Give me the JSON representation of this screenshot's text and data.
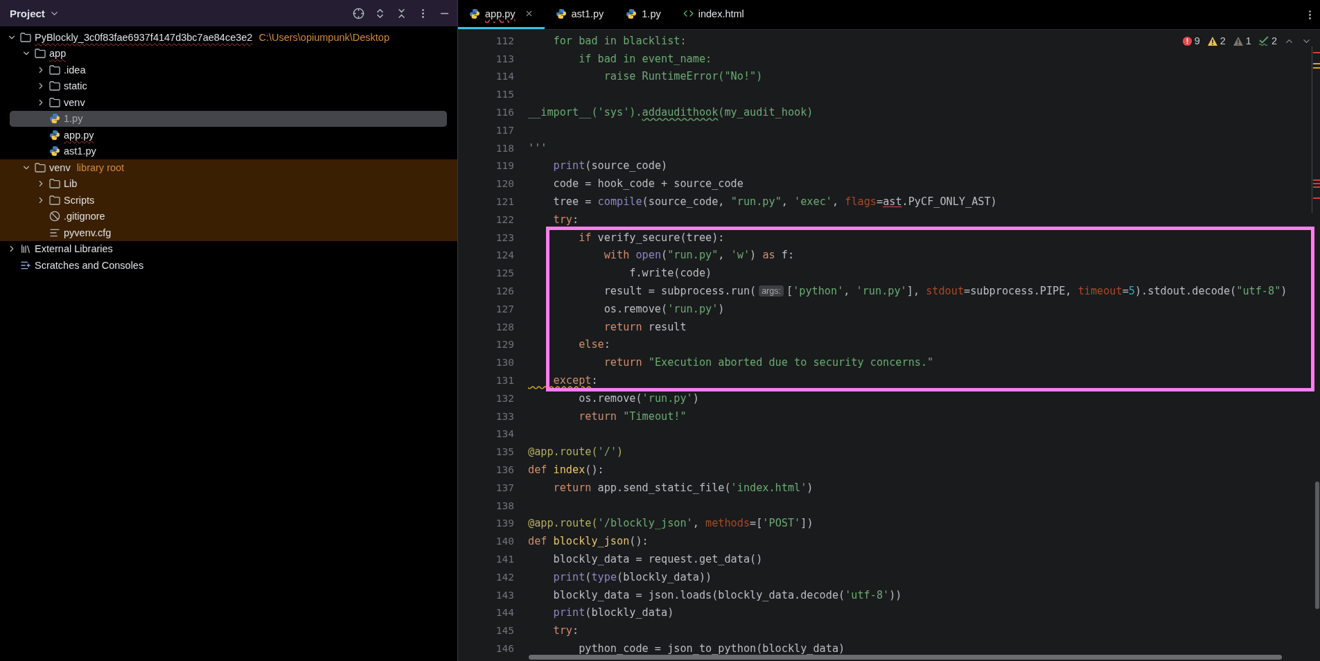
{
  "project_panel": {
    "title": "Project",
    "tree": [
      {
        "name": "PyBlockly_3c0f83fae6937f4147d3bc7ae84ce3e2",
        "kind": "folder",
        "expanded": true,
        "typo": true,
        "hint": "C:\\Users\\opiumpunk\\Desktop",
        "children": [
          {
            "name": "app",
            "kind": "folder",
            "expanded": true,
            "typo": true,
            "children": [
              {
                "name": ".idea",
                "kind": "folder",
                "expanded": false
              },
              {
                "name": "static",
                "kind": "folder",
                "expanded": false
              },
              {
                "name": "venv",
                "kind": "folder",
                "expanded": false
              },
              {
                "name": "1.py",
                "kind": "python",
                "selected": true
              },
              {
                "name": "app.py",
                "kind": "python",
                "selected": false,
                "typo": true
              },
              {
                "name": "ast1.py",
                "kind": "python",
                "selected": false
              }
            ]
          },
          {
            "name": "venv",
            "kind": "folder",
            "expanded": true,
            "library": true,
            "hint": "library root",
            "children": [
              {
                "name": "Lib",
                "kind": "folder",
                "expanded": false
              },
              {
                "name": "Scripts",
                "kind": "folder",
                "expanded": false
              },
              {
                "name": ".gitignore",
                "kind": "ignore"
              },
              {
                "name": "pyvenv.cfg",
                "kind": "config"
              }
            ]
          }
        ]
      },
      {
        "name": "External Libraries",
        "kind": "libraries",
        "expanded": false
      },
      {
        "name": "Scratches and Consoles",
        "kind": "scratches"
      }
    ]
  },
  "tabs": [
    {
      "label": "app.py",
      "kind": "python",
      "selected": true,
      "typo": true
    },
    {
      "label": "ast1.py",
      "kind": "python",
      "selected": false,
      "typo": false
    },
    {
      "label": "1.py",
      "kind": "python",
      "selected": false,
      "typo": false
    },
    {
      "label": "index.html",
      "kind": "html",
      "selected": false,
      "typo": false
    }
  ],
  "problems": [
    {
      "kind": "error",
      "count": "9"
    },
    {
      "kind": "warning",
      "count": "2"
    },
    {
      "kind": "weak",
      "count": "1"
    },
    {
      "kind": "typo",
      "count": "2"
    }
  ],
  "lines": [
    {
      "number": "112",
      "tokens": [
        {
          "text": "    for bad in blacklist:",
          "kind": "str"
        }
      ]
    },
    {
      "number": "113",
      "tokens": [
        {
          "text": "        if bad in event_name:",
          "kind": "str"
        }
      ]
    },
    {
      "number": "114",
      "tokens": [
        {
          "text": "            raise RuntimeError(\"No!\")",
          "kind": "str"
        }
      ]
    },
    {
      "number": "115"
    },
    {
      "number": "116",
      "tokens": [
        {
          "text": "__import__('sys').",
          "kind": "str"
        },
        {
          "text": "addaudithook",
          "kind": "str",
          "typo": true
        },
        {
          "text": "(my_audit_hook)",
          "kind": "str"
        }
      ]
    },
    {
      "number": "117"
    },
    {
      "number": "118",
      "tokens": [
        {
          "text": "'''",
          "kind": "str"
        }
      ]
    },
    {
      "number": "119",
      "tokens": [
        {
          "text": "    print",
          "kind": "call"
        },
        {
          "text": "(source_code)",
          "kind": "plain"
        }
      ]
    },
    {
      "number": "120",
      "tokens": [
        {
          "text": "    code = hook_code + source_code",
          "kind": "plain"
        }
      ]
    },
    {
      "number": "121",
      "tokens": [
        {
          "text": "    tree = ",
          "kind": "plain"
        },
        {
          "text": "compile",
          "kind": "call"
        },
        {
          "text": "(source_code, ",
          "kind": "plain"
        },
        {
          "text": "\"run.py\"",
          "kind": "str"
        },
        {
          "text": ", ",
          "kind": "plain"
        },
        {
          "text": "'exec'",
          "kind": "str"
        },
        {
          "text": ", ",
          "kind": "plain"
        },
        {
          "text": "flags",
          "kind": "param"
        },
        {
          "text": "=",
          "kind": "plain"
        },
        {
          "text": "ast",
          "kind": "plain",
          "error": true
        },
        {
          "text": ".PyCF_ONLY_AST)",
          "kind": "plain"
        }
      ]
    },
    {
      "number": "122",
      "tokens": [
        {
          "text": "    try",
          "kind": "kw"
        },
        {
          "text": ":",
          "kind": "plain"
        }
      ]
    },
    {
      "number": "123",
      "tokens": [
        {
          "text": "        if",
          "kind": "kw"
        },
        {
          "text": " verify_secure(tree):",
          "kind": "plain"
        }
      ]
    },
    {
      "number": "124",
      "tokens": [
        {
          "text": "            with",
          "kind": "kw"
        },
        {
          "text": " open",
          "kind": "call"
        },
        {
          "text": "(",
          "kind": "plain"
        },
        {
          "text": "\"run.py\"",
          "kind": "str"
        },
        {
          "text": ", ",
          "kind": "plain"
        },
        {
          "text": "'w'",
          "kind": "str"
        },
        {
          "text": ") ",
          "kind": "plain"
        },
        {
          "text": "as",
          "kind": "kw"
        },
        {
          "text": " f:",
          "kind": "plain"
        }
      ]
    },
    {
      "number": "125",
      "tokens": [
        {
          "text": "                f.write(code)",
          "kind": "plain"
        }
      ]
    },
    {
      "number": "126",
      "tokens": [
        {
          "text": "            result = subprocess.run(",
          "kind": "plain"
        },
        {
          "text": "args:",
          "kind": "hint"
        },
        {
          "text": "[",
          "kind": "plain"
        },
        {
          "text": "'python'",
          "kind": "str"
        },
        {
          "text": ", ",
          "kind": "plain"
        },
        {
          "text": "'run.py'",
          "kind": "str"
        },
        {
          "text": "], ",
          "kind": "plain"
        },
        {
          "text": "stdout",
          "kind": "param"
        },
        {
          "text": "=subprocess.PIPE, ",
          "kind": "plain"
        },
        {
          "text": "timeout",
          "kind": "param"
        },
        {
          "text": "=",
          "kind": "plain"
        },
        {
          "text": "5",
          "kind": "num"
        },
        {
          "text": ").stdout.decode(",
          "kind": "plain"
        },
        {
          "text": "\"utf-8\"",
          "kind": "str"
        },
        {
          "text": ")",
          "kind": "plain"
        }
      ]
    },
    {
      "number": "127",
      "tokens": [
        {
          "text": "            os.remove(",
          "kind": "plain"
        },
        {
          "text": "'run.py'",
          "kind": "str"
        },
        {
          "text": ")",
          "kind": "plain"
        }
      ]
    },
    {
      "number": "128",
      "tokens": [
        {
          "text": "            return",
          "kind": "kw"
        },
        {
          "text": " result",
          "kind": "plain"
        }
      ]
    },
    {
      "number": "129",
      "tokens": [
        {
          "text": "        else",
          "kind": "kw"
        },
        {
          "text": ":",
          "kind": "plain"
        }
      ]
    },
    {
      "number": "130",
      "tokens": [
        {
          "text": "            return",
          "kind": "kw"
        },
        {
          "text": " \"Execution aborted due to security concerns.\"",
          "kind": "str"
        }
      ]
    },
    {
      "number": "131",
      "tokens": [
        {
          "text": "    except",
          "kind": "kw",
          "warning": true
        },
        {
          "text": ":",
          "kind": "plain"
        }
      ]
    },
    {
      "number": "132",
      "tokens": [
        {
          "text": "        os.remove(",
          "kind": "plain"
        },
        {
          "text": "'run.py'",
          "kind": "str"
        },
        {
          "text": ")",
          "kind": "plain"
        }
      ]
    },
    {
      "number": "133",
      "tokens": [
        {
          "text": "        return",
          "kind": "kw"
        },
        {
          "text": " \"Timeout!\"",
          "kind": "str"
        }
      ]
    },
    {
      "number": "134"
    },
    {
      "number": "135",
      "tokens": [
        {
          "text": "@app.route(",
          "kind": "deco"
        },
        {
          "text": "'/'",
          "kind": "str"
        },
        {
          "text": ")",
          "kind": "deco"
        }
      ]
    },
    {
      "number": "136",
      "tokens": [
        {
          "text": "def",
          "kind": "kw"
        },
        {
          "text": " index",
          "kind": "def"
        },
        {
          "text": "():",
          "kind": "plain"
        }
      ]
    },
    {
      "number": "137",
      "tokens": [
        {
          "text": "    return",
          "kind": "kw"
        },
        {
          "text": " app.send_static_file(",
          "kind": "plain"
        },
        {
          "text": "'index.html'",
          "kind": "str"
        },
        {
          "text": ")",
          "kind": "plain"
        }
      ]
    },
    {
      "number": "138"
    },
    {
      "number": "139",
      "tokens": [
        {
          "text": "@app.route(",
          "kind": "deco"
        },
        {
          "text": "'/blockly_json'",
          "kind": "str"
        },
        {
          "text": ", ",
          "kind": "plain"
        },
        {
          "text": "methods",
          "kind": "param"
        },
        {
          "text": "=[",
          "kind": "plain"
        },
        {
          "text": "'POST'",
          "kind": "str"
        },
        {
          "text": "])",
          "kind": "plain"
        }
      ]
    },
    {
      "number": "140",
      "tokens": [
        {
          "text": "def",
          "kind": "kw"
        },
        {
          "text": " blockly_json",
          "kind": "def"
        },
        {
          "text": "():",
          "kind": "plain"
        }
      ]
    },
    {
      "number": "141",
      "tokens": [
        {
          "text": "    blockly_data = request.get_data()",
          "kind": "plain"
        }
      ]
    },
    {
      "number": "142",
      "tokens": [
        {
          "text": "    print",
          "kind": "call"
        },
        {
          "text": "(",
          "kind": "plain"
        },
        {
          "text": "type",
          "kind": "call"
        },
        {
          "text": "(blockly_data))",
          "kind": "plain"
        }
      ]
    },
    {
      "number": "143",
      "tokens": [
        {
          "text": "    blockly_data = json.loads(blockly_data.decode(",
          "kind": "plain"
        },
        {
          "text": "'utf-8'",
          "kind": "str"
        },
        {
          "text": "))",
          "kind": "plain"
        }
      ]
    },
    {
      "number": "144",
      "tokens": [
        {
          "text": "    print",
          "kind": "call"
        },
        {
          "text": "(blockly_data)",
          "kind": "plain"
        }
      ]
    },
    {
      "number": "145",
      "tokens": [
        {
          "text": "    try",
          "kind": "kw"
        },
        {
          "text": ":",
          "kind": "plain"
        }
      ]
    },
    {
      "number": "146",
      "tokens": [
        {
          "text": "        python_code = json_to_python(blockly_data)",
          "kind": "plain"
        }
      ]
    }
  ]
}
